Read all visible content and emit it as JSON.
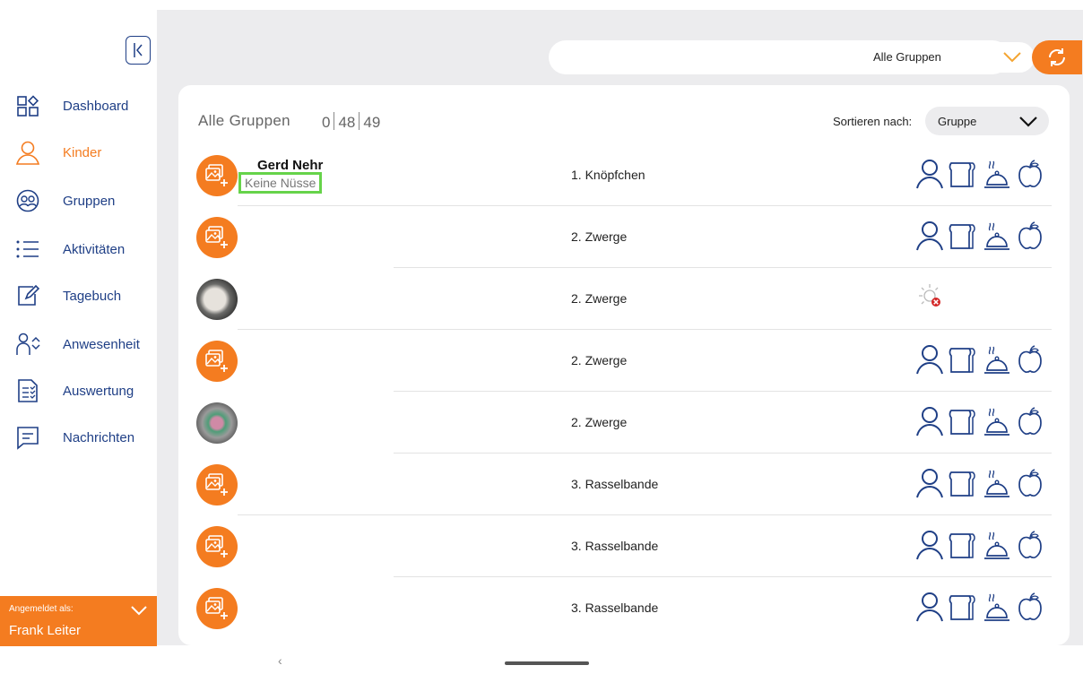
{
  "sidebar": {
    "items": [
      {
        "label": "Dashboard",
        "icon": "dashboard-icon",
        "active": false
      },
      {
        "label": "Kinder",
        "icon": "person-icon",
        "active": true
      },
      {
        "label": "Gruppen",
        "icon": "group-icon",
        "active": false
      },
      {
        "label": "Aktivitäten",
        "icon": "list-icon",
        "active": false
      },
      {
        "label": "Tagebuch",
        "icon": "edit-icon",
        "active": false
      },
      {
        "label": "Anwesenheit",
        "icon": "attendance-icon",
        "active": false
      },
      {
        "label": "Auswertung",
        "icon": "report-icon",
        "active": false
      },
      {
        "label": "Nachrichten",
        "icon": "message-icon",
        "active": false
      }
    ],
    "user": {
      "logged_in_label": "Angemeldet als:",
      "name": "Frank Leiter"
    }
  },
  "toolbar": {
    "search_value": "",
    "group_filter": "Alle Gruppen"
  },
  "list": {
    "title": "Alle Gruppen",
    "counts": [
      "0",
      "48",
      "49"
    ],
    "sort_label": "Sortieren nach:",
    "sort_value": "Gruppe",
    "rows": [
      {
        "name": "Gerd Nehr",
        "note": "Keine Nüsse",
        "group": "1. Knöpfchen",
        "avatar": "placeholder",
        "status": "icons"
      },
      {
        "name": "",
        "note": "",
        "group": "2. Zwerge",
        "avatar": "placeholder",
        "status": "icons"
      },
      {
        "name": "",
        "note": "",
        "group": "2. Zwerge",
        "avatar": "photo1",
        "status": "absent"
      },
      {
        "name": "",
        "note": "",
        "group": "2. Zwerge",
        "avatar": "placeholder",
        "status": "icons"
      },
      {
        "name": "",
        "note": "",
        "group": "2. Zwerge",
        "avatar": "photo2",
        "status": "icons"
      },
      {
        "name": "",
        "note": "",
        "group": "3. Rasselbande",
        "avatar": "placeholder",
        "status": "icons"
      },
      {
        "name": "",
        "note": "",
        "group": "3. Rasselbande",
        "avatar": "placeholder",
        "status": "icons"
      },
      {
        "name": "",
        "note": "",
        "group": "3. Rasselbande",
        "avatar": "placeholder",
        "status": "icons"
      }
    ]
  },
  "colors": {
    "accent": "#f47c20",
    "navy": "#1f3f86",
    "highlight": "#66d34a"
  }
}
